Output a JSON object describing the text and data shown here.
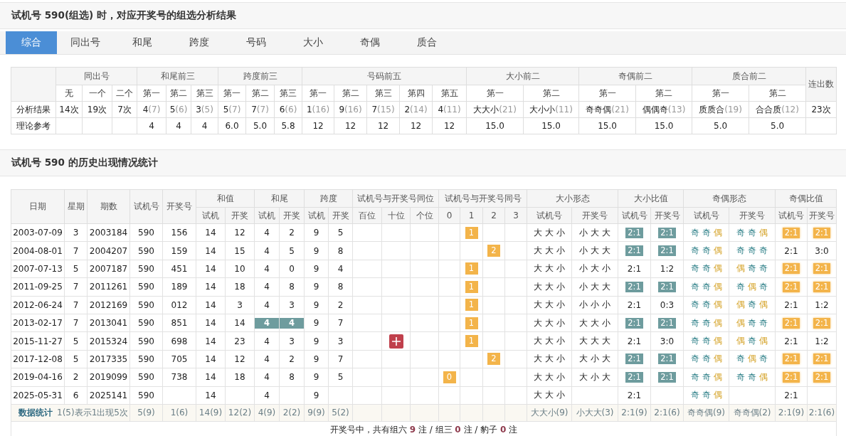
{
  "analysis": {
    "title": "试机号 590(组选) 时，对应开奖号的组选分析结果",
    "tabs": [
      {
        "label": "综合",
        "selected": true
      },
      {
        "label": "同出号",
        "selected": false
      },
      {
        "label": "和尾",
        "selected": false
      },
      {
        "label": "跨度",
        "selected": false
      },
      {
        "label": "号码",
        "selected": false
      },
      {
        "label": "大小",
        "selected": false
      },
      {
        "label": "奇偶",
        "selected": false
      },
      {
        "label": "质合",
        "selected": false
      }
    ],
    "groups": [
      {
        "label": "同出号",
        "subs": [
          "无",
          "一个",
          "二个"
        ]
      },
      {
        "label": "和尾前三",
        "subs": [
          "第一",
          "第二",
          "第三"
        ]
      },
      {
        "label": "跨度前三",
        "subs": [
          "第一",
          "第二",
          "第三"
        ]
      },
      {
        "label": "号码前五",
        "subs": [
          "第一",
          "第二",
          "第三",
          "第四",
          "第五"
        ]
      },
      {
        "label": "大小前二",
        "subs": [
          "第一",
          "第二"
        ]
      },
      {
        "label": "奇偶前二",
        "subs": [
          "第一",
          "第二"
        ]
      },
      {
        "label": "质合前二",
        "subs": [
          "第一",
          "第二"
        ]
      }
    ],
    "last_column": "连出数",
    "rows": [
      {
        "label": "分析结果",
        "cells": [
          {
            "v": "14次"
          },
          {
            "v": "19次"
          },
          {
            "v": "7次"
          },
          {
            "v": "4",
            "n": "(7)"
          },
          {
            "v": "5",
            "n": "(6)"
          },
          {
            "v": "3",
            "n": "(5)"
          },
          {
            "v": "5",
            "n": "(7)"
          },
          {
            "v": "7",
            "n": "(7)"
          },
          {
            "v": "6",
            "n": "(6)"
          },
          {
            "v": "1",
            "n": "(16)"
          },
          {
            "v": "9",
            "n": "(16)"
          },
          {
            "v": "7",
            "n": "(15)"
          },
          {
            "v": "2",
            "n": "(14)"
          },
          {
            "v": "4",
            "n": "(11)"
          },
          {
            "v": "大大小",
            "n": "(21)"
          },
          {
            "v": "大小小",
            "n": "(11)"
          },
          {
            "v": "奇奇偶",
            "n": "(21)"
          },
          {
            "v": "偶偶奇",
            "n": "(13)"
          },
          {
            "v": "质质合",
            "n": "(19)"
          },
          {
            "v": "合合质",
            "n": "(12)"
          },
          {
            "v": "23次"
          }
        ]
      },
      {
        "label": "理论参考",
        "cells": [
          {},
          {},
          {},
          {
            "v": "4"
          },
          {
            "v": "4"
          },
          {
            "v": "4"
          },
          {
            "v": "6.0"
          },
          {
            "v": "5.0"
          },
          {
            "v": "5.8"
          },
          {
            "v": "12"
          },
          {
            "v": "12"
          },
          {
            "v": "12"
          },
          {
            "v": "12"
          },
          {
            "v": "12"
          },
          {
            "v": "15.0"
          },
          {
            "v": "15.0"
          },
          {
            "v": "15.0"
          },
          {
            "v": "15.0"
          },
          {
            "v": "5.0"
          },
          {
            "v": "5.0"
          },
          {}
        ]
      }
    ]
  },
  "history": {
    "title": "试机号 590 的历史出现情况统计",
    "columns": [
      {
        "label": "日期"
      },
      {
        "label": "星期"
      },
      {
        "label": "期数"
      },
      {
        "label": "试机号"
      },
      {
        "label": "开奖号"
      },
      {
        "label": "和值",
        "subs": [
          "试机",
          "开奖"
        ]
      },
      {
        "label": "和尾",
        "subs": [
          "试机",
          "开奖"
        ]
      },
      {
        "label": "跨度",
        "subs": [
          "试机",
          "开奖"
        ]
      },
      {
        "label": "试机号与开奖号同位",
        "subs": [
          "百位",
          "十位",
          "个位"
        ]
      },
      {
        "label": "试机号与开奖号同号",
        "subs": [
          "0",
          "1",
          "2",
          "3"
        ]
      },
      {
        "label": "大小形态",
        "subs": [
          "试机号",
          "开奖号"
        ]
      },
      {
        "label": "大小比值",
        "subs": [
          "试机号",
          "开奖号"
        ]
      },
      {
        "label": "奇偶形态",
        "subs": [
          "试机号",
          "开奖号"
        ]
      },
      {
        "label": "奇偶比值",
        "subs": [
          "试机号",
          "开奖号"
        ]
      }
    ],
    "rows": [
      {
        "date": "2003-07-09",
        "week": "3",
        "issue": "2003184",
        "trial": "590",
        "draw": "156",
        "sum_t": "14",
        "sum_d": "12",
        "tail_t": {
          "text": "4",
          "hl": false
        },
        "tail_d": {
          "text": "2",
          "hl": false
        },
        "span_t": "9",
        "span_d": "5",
        "same_pos": [
          false,
          false,
          false
        ],
        "same_hit": [
          false,
          true,
          false,
          false
        ],
        "same_num": "1",
        "size_t": "大大小",
        "size_d": "小大大",
        "sr_t": {
          "text": "2:1",
          "hl": true
        },
        "sr_d": {
          "text": "2:1",
          "hl": true
        },
        "oe_t": [
          {
            "t": "奇",
            "kind": "odd"
          },
          {
            "t": "奇",
            "kind": "odd"
          },
          {
            "t": "偶",
            "kind": "even"
          }
        ],
        "oe_d": [
          {
            "t": "奇",
            "kind": "odd"
          },
          {
            "t": "奇",
            "kind": "odd"
          },
          {
            "t": "偶",
            "kind": "even"
          }
        ],
        "or_t": {
          "text": "2:1",
          "hl": true
        },
        "or_d": {
          "text": "2:1",
          "hl": true
        }
      },
      {
        "date": "2004-08-01",
        "week": "7",
        "issue": "2004207",
        "trial": "590",
        "draw": "159",
        "sum_t": "14",
        "sum_d": "15",
        "tail_t": {
          "text": "4",
          "hl": false
        },
        "tail_d": {
          "text": "5",
          "hl": false
        },
        "span_t": "9",
        "span_d": "8",
        "same_pos": [
          false,
          false,
          false
        ],
        "same_hit": [
          false,
          false,
          true,
          false
        ],
        "same_num": "2",
        "size_t": "大大小",
        "size_d": "小大大",
        "sr_t": {
          "text": "2:1",
          "hl": true
        },
        "sr_d": {
          "text": "2:1",
          "hl": true
        },
        "oe_t": [
          {
            "t": "奇",
            "kind": "odd"
          },
          {
            "t": "奇",
            "kind": "odd"
          },
          {
            "t": "偶",
            "kind": "even"
          }
        ],
        "oe_d": [
          {
            "t": "奇",
            "kind": "odd"
          },
          {
            "t": "奇",
            "kind": "odd"
          },
          {
            "t": "奇",
            "kind": "odd"
          }
        ],
        "or_t": {
          "text": "2:1",
          "hl": false
        },
        "or_d": {
          "text": "3:0",
          "hl": false
        }
      },
      {
        "date": "2007-07-13",
        "week": "5",
        "issue": "2007187",
        "trial": "590",
        "draw": "451",
        "sum_t": "14",
        "sum_d": "10",
        "tail_t": {
          "text": "4",
          "hl": false
        },
        "tail_d": {
          "text": "0",
          "hl": false
        },
        "span_t": "9",
        "span_d": "4",
        "same_pos": [
          false,
          false,
          false
        ],
        "same_hit": [
          false,
          true,
          false,
          false
        ],
        "same_num": "1",
        "size_t": "大大小",
        "size_d": "小大小",
        "sr_t": {
          "text": "2:1",
          "hl": false
        },
        "sr_d": {
          "text": "1:2",
          "hl": false
        },
        "oe_t": [
          {
            "t": "奇",
            "kind": "odd"
          },
          {
            "t": "奇",
            "kind": "odd"
          },
          {
            "t": "偶",
            "kind": "even"
          }
        ],
        "oe_d": [
          {
            "t": "偶",
            "kind": "even"
          },
          {
            "t": "奇",
            "kind": "odd"
          },
          {
            "t": "奇",
            "kind": "odd"
          }
        ],
        "or_t": {
          "text": "2:1",
          "hl": true
        },
        "or_d": {
          "text": "2:1",
          "hl": true
        }
      },
      {
        "date": "2011-09-25",
        "week": "7",
        "issue": "2011261",
        "trial": "590",
        "draw": "189",
        "sum_t": "14",
        "sum_d": "18",
        "tail_t": {
          "text": "4",
          "hl": false
        },
        "tail_d": {
          "text": "8",
          "hl": false
        },
        "span_t": "9",
        "span_d": "8",
        "same_pos": [
          false,
          false,
          false
        ],
        "same_hit": [
          false,
          true,
          false,
          false
        ],
        "same_num": "1",
        "size_t": "大大小",
        "size_d": "小大大",
        "sr_t": {
          "text": "2:1",
          "hl": true
        },
        "sr_d": {
          "text": "2:1",
          "hl": true
        },
        "oe_t": [
          {
            "t": "奇",
            "kind": "odd"
          },
          {
            "t": "奇",
            "kind": "odd"
          },
          {
            "t": "偶",
            "kind": "even"
          }
        ],
        "oe_d": [
          {
            "t": "奇",
            "kind": "odd"
          },
          {
            "t": "偶",
            "kind": "even"
          },
          {
            "t": "奇",
            "kind": "odd"
          }
        ],
        "or_t": {
          "text": "2:1",
          "hl": true
        },
        "or_d": {
          "text": "2:1",
          "hl": true
        }
      },
      {
        "date": "2012-06-24",
        "week": "7",
        "issue": "2012169",
        "trial": "590",
        "draw": "012",
        "sum_t": "14",
        "sum_d": "3",
        "tail_t": {
          "text": "4",
          "hl": false
        },
        "tail_d": {
          "text": "3",
          "hl": false
        },
        "span_t": "9",
        "span_d": "2",
        "same_pos": [
          false,
          false,
          false
        ],
        "same_hit": [
          false,
          true,
          false,
          false
        ],
        "same_num": "1",
        "size_t": "大大小",
        "size_d": "小小小",
        "sr_t": {
          "text": "2:1",
          "hl": false
        },
        "sr_d": {
          "text": "0:3",
          "hl": false
        },
        "oe_t": [
          {
            "t": "奇",
            "kind": "odd"
          },
          {
            "t": "奇",
            "kind": "odd"
          },
          {
            "t": "偶",
            "kind": "even"
          }
        ],
        "oe_d": [
          {
            "t": "偶",
            "kind": "even"
          },
          {
            "t": "奇",
            "kind": "odd"
          },
          {
            "t": "偶",
            "kind": "even"
          }
        ],
        "or_t": {
          "text": "2:1",
          "hl": false
        },
        "or_d": {
          "text": "1:2",
          "hl": false
        }
      },
      {
        "date": "2013-02-17",
        "week": "7",
        "issue": "2013041",
        "trial": "590",
        "draw": "851",
        "sum_t": "14",
        "sum_d": "14",
        "tail_t": {
          "text": "4",
          "hl": true
        },
        "tail_d": {
          "text": "4",
          "hl": true
        },
        "span_t": "9",
        "span_d": "7",
        "same_pos": [
          false,
          false,
          false
        ],
        "same_hit": [
          false,
          true,
          false,
          false
        ],
        "same_num": "1",
        "size_t": "大大小",
        "size_d": "大大小",
        "sr_t": {
          "text": "2:1",
          "hl": true
        },
        "sr_d": {
          "text": "2:1",
          "hl": true
        },
        "oe_t": [
          {
            "t": "奇",
            "kind": "odd"
          },
          {
            "t": "奇",
            "kind": "odd"
          },
          {
            "t": "偶",
            "kind": "even"
          }
        ],
        "oe_d": [
          {
            "t": "偶",
            "kind": "even"
          },
          {
            "t": "奇",
            "kind": "odd"
          },
          {
            "t": "奇",
            "kind": "odd"
          }
        ],
        "or_t": {
          "text": "2:1",
          "hl": true
        },
        "or_d": {
          "text": "2:1",
          "hl": true
        }
      },
      {
        "date": "2015-11-27",
        "week": "5",
        "issue": "2015324",
        "trial": "590",
        "draw": "698",
        "sum_t": "14",
        "sum_d": "23",
        "tail_t": {
          "text": "4",
          "hl": false
        },
        "tail_d": {
          "text": "3",
          "hl": false
        },
        "span_t": "9",
        "span_d": "3",
        "same_pos": [
          false,
          true,
          false
        ],
        "same_hit": [
          false,
          true,
          false,
          false
        ],
        "same_num": "1",
        "size_t": "大大小",
        "size_d": "大大大",
        "sr_t": {
          "text": "2:1",
          "hl": false
        },
        "sr_d": {
          "text": "3:0",
          "hl": false
        },
        "oe_t": [
          {
            "t": "奇",
            "kind": "odd"
          },
          {
            "t": "奇",
            "kind": "odd"
          },
          {
            "t": "偶",
            "kind": "even"
          }
        ],
        "oe_d": [
          {
            "t": "偶",
            "kind": "even"
          },
          {
            "t": "奇",
            "kind": "odd"
          },
          {
            "t": "偶",
            "kind": "even"
          }
        ],
        "or_t": {
          "text": "2:1",
          "hl": false
        },
        "or_d": {
          "text": "1:2",
          "hl": false
        }
      },
      {
        "date": "2017-12-08",
        "week": "5",
        "issue": "2017335",
        "trial": "590",
        "draw": "705",
        "sum_t": "14",
        "sum_d": "12",
        "tail_t": {
          "text": "4",
          "hl": false
        },
        "tail_d": {
          "text": "2",
          "hl": false
        },
        "span_t": "9",
        "span_d": "7",
        "same_pos": [
          false,
          false,
          false
        ],
        "same_hit": [
          false,
          false,
          true,
          false
        ],
        "same_num": "2",
        "size_t": "大大小",
        "size_d": "大小大",
        "sr_t": {
          "text": "2:1",
          "hl": true
        },
        "sr_d": {
          "text": "2:1",
          "hl": true
        },
        "oe_t": [
          {
            "t": "奇",
            "kind": "odd"
          },
          {
            "t": "奇",
            "kind": "odd"
          },
          {
            "t": "偶",
            "kind": "even"
          }
        ],
        "oe_d": [
          {
            "t": "奇",
            "kind": "odd"
          },
          {
            "t": "偶",
            "kind": "even"
          },
          {
            "t": "奇",
            "kind": "odd"
          }
        ],
        "or_t": {
          "text": "2:1",
          "hl": true
        },
        "or_d": {
          "text": "2:1",
          "hl": true
        }
      },
      {
        "date": "2019-04-16",
        "week": "2",
        "issue": "2019099",
        "trial": "590",
        "draw": "738",
        "sum_t": "14",
        "sum_d": "18",
        "tail_t": {
          "text": "4",
          "hl": false
        },
        "tail_d": {
          "text": "8",
          "hl": false
        },
        "span_t": "9",
        "span_d": "5",
        "same_pos": [
          false,
          false,
          false
        ],
        "same_hit": [
          true,
          false,
          false,
          false
        ],
        "same_num": "0",
        "size_t": "大大小",
        "size_d": "大小大",
        "sr_t": {
          "text": "2:1",
          "hl": true
        },
        "sr_d": {
          "text": "2:1",
          "hl": true
        },
        "oe_t": [
          {
            "t": "奇",
            "kind": "odd"
          },
          {
            "t": "奇",
            "kind": "odd"
          },
          {
            "t": "偶",
            "kind": "even"
          }
        ],
        "oe_d": [
          {
            "t": "奇",
            "kind": "odd"
          },
          {
            "t": "奇",
            "kind": "odd"
          },
          {
            "t": "偶",
            "kind": "even"
          }
        ],
        "or_t": {
          "text": "2:1",
          "hl": true
        },
        "or_d": {
          "text": "2:1",
          "hl": true
        }
      },
      {
        "date": "2025-05-31",
        "week": "6",
        "issue": "2025141",
        "trial": "590",
        "sum_t": "14",
        "tail_t": {
          "text": "4",
          "hl": false
        },
        "span_t": "9",
        "same_pos": [
          false,
          false,
          false
        ],
        "same_hit": [
          false,
          false,
          false,
          false
        ],
        "size_t": "大大小",
        "sr_t": {
          "text": "2:1",
          "hl": false
        },
        "oe_t": [
          {
            "t": "奇",
            "kind": "odd"
          },
          {
            "t": "奇",
            "kind": "odd"
          },
          {
            "t": "偶",
            "kind": "even"
          }
        ],
        "or_t": {
          "text": "2:1",
          "hl": false
        }
      }
    ],
    "stats": {
      "label": "数据统计",
      "note": "1(5)表示1出现5次",
      "cells": [
        {
          "v": "5(9)"
        },
        {
          "v": "1(6)"
        },
        {
          "v": "14(9)"
        },
        {
          "v": "12(2)"
        },
        {
          "v": "4(9)"
        },
        {
          "v": "2(2)"
        },
        {
          "v": "9(9)"
        },
        {
          "v": "5(2)"
        },
        {},
        {},
        {},
        {},
        {},
        {},
        {},
        {
          "v": "大大小(9)"
        },
        {
          "v": "小大大(3)"
        },
        {
          "v": "2:1(9)"
        },
        {
          "v": "2:1(6)"
        },
        {
          "v": "奇奇偶(9)"
        },
        {
          "v": "奇奇偶(2)"
        },
        {
          "v": "2:1(9)"
        },
        {
          "v": "2:1(6)"
        }
      ]
    },
    "footer": "开奖号中，共有组六 **9** 注 / 组三 **0** 注 / 豹子 **0** 注"
  }
}
